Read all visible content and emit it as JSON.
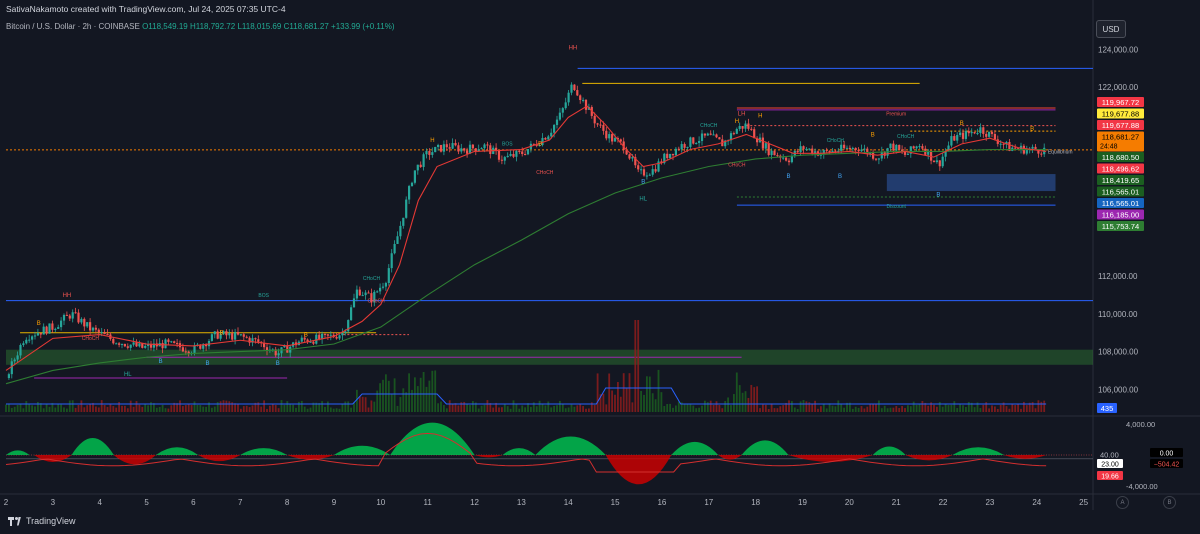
{
  "header": {
    "credit": "SativaNakamoto created with TradingView.com, Jul 24, 2025 07:35 UTC-4",
    "symbol": "Bitcoin / U.S. Dollar · 2h · COINBASE",
    "open": "O118,549.19",
    "high": "H118,792.72",
    "low": "L118,015.69",
    "close": "C118,681.27",
    "change": "+133.99 (+0.11%)"
  },
  "currency_button": "USD",
  "footer": {
    "brand": "TradingView",
    "btn_a": "A",
    "btn_b": "B"
  },
  "colors": {
    "background": "#131722",
    "up": "#26a69a",
    "down": "#ef5350",
    "bull_zone": "#2e7d32",
    "discount_zone": "#1e3a66",
    "ema": "#2e7d32",
    "sma": "#e53935"
  },
  "chart_data": [
    {
      "type": "candlestick",
      "title": "Bitcoin / U.S. Dollar · 2h · COINBASE",
      "y_axis_ticks": [
        "124,000.00",
        "122,000.00",
        "112,000.00",
        "110,000.00",
        "108,000.00",
        "106,000.00"
      ],
      "ylim": [
        104800,
        124500
      ],
      "x_ticks": [
        "2",
        "3",
        "4",
        "5",
        "6",
        "7",
        "8",
        "9",
        "10",
        "11",
        "12",
        "13",
        "14",
        "15",
        "16",
        "17",
        "18",
        "19",
        "20",
        "21",
        "22",
        "23",
        "24",
        "25"
      ],
      "xlim": [
        2,
        25.2
      ],
      "path": [
        [
          2,
          106600
        ],
        [
          2.4,
          108800
        ],
        [
          3,
          109300
        ],
        [
          3.4,
          110000
        ],
        [
          3.8,
          109200
        ],
        [
          4.3,
          108600
        ],
        [
          4.9,
          108200
        ],
        [
          5.4,
          108400
        ],
        [
          6,
          108100
        ],
        [
          6.5,
          108900
        ],
        [
          7,
          108800
        ],
        [
          7.4,
          108500
        ],
        [
          7.8,
          107900
        ],
        [
          8.3,
          108600
        ],
        [
          8.8,
          108700
        ],
        [
          9.2,
          109000
        ],
        [
          9.5,
          111300
        ],
        [
          9.8,
          110800
        ],
        [
          10.1,
          111800
        ],
        [
          10.4,
          114500
        ],
        [
          10.7,
          117500
        ],
        [
          11,
          118500
        ],
        [
          11.4,
          118900
        ],
        [
          11.8,
          118700
        ],
        [
          12.2,
          118900
        ],
        [
          12.6,
          118200
        ],
        [
          13,
          118500
        ],
        [
          13.3,
          119000
        ],
        [
          13.6,
          119600
        ],
        [
          13.85,
          120600
        ],
        [
          14.1,
          122200
        ],
        [
          14.35,
          121100
        ],
        [
          14.6,
          120100
        ],
        [
          14.9,
          119300
        ],
        [
          15.2,
          118900
        ],
        [
          15.5,
          117400
        ],
        [
          15.8,
          117600
        ],
        [
          16.1,
          118400
        ],
        [
          16.4,
          118900
        ],
        [
          16.7,
          119200
        ],
        [
          17,
          119400
        ],
        [
          17.3,
          119000
        ],
        [
          17.6,
          119800
        ],
        [
          17.8,
          120000
        ],
        [
          18,
          119400
        ],
        [
          18.3,
          118600
        ],
        [
          18.7,
          118200
        ],
        [
          19,
          118800
        ],
        [
          19.4,
          118500
        ],
        [
          19.8,
          118700
        ],
        [
          20.2,
          118800
        ],
        [
          20.6,
          118300
        ],
        [
          20.9,
          118900
        ],
        [
          21.2,
          118400
        ],
        [
          21.5,
          119000
        ],
        [
          21.9,
          117900
        ],
        [
          22.2,
          119300
        ],
        [
          22.5,
          119500
        ],
        [
          22.8,
          119800
        ],
        [
          23.1,
          119300
        ],
        [
          23.4,
          118800
        ],
        [
          23.8,
          118700
        ],
        [
          24.2,
          118681
        ]
      ],
      "ema_path": [
        [
          2,
          106300
        ],
        [
          3,
          107000
        ],
        [
          4,
          107400
        ],
        [
          5,
          107700
        ],
        [
          6,
          107900
        ],
        [
          7,
          108000
        ],
        [
          8,
          108100
        ],
        [
          9,
          108400
        ],
        [
          10,
          109300
        ],
        [
          11,
          111000
        ],
        [
          12,
          112600
        ],
        [
          13,
          113900
        ],
        [
          14,
          115300
        ],
        [
          15,
          116400
        ],
        [
          16,
          117200
        ],
        [
          17,
          117800
        ],
        [
          18,
          118200
        ],
        [
          19,
          118400
        ],
        [
          20,
          118500
        ],
        [
          21,
          118600
        ],
        [
          22,
          118600
        ],
        [
          23,
          118700
        ],
        [
          24.2,
          118700
        ]
      ],
      "sma_path": [
        [
          2,
          107000
        ],
        [
          3,
          108700
        ],
        [
          4,
          108900
        ],
        [
          5,
          108400
        ],
        [
          6,
          108300
        ],
        [
          7,
          108600
        ],
        [
          8,
          108300
        ],
        [
          9,
          108800
        ],
        [
          9.6,
          109600
        ],
        [
          10,
          110500
        ],
        [
          10.4,
          112600
        ],
        [
          10.8,
          116000
        ],
        [
          11.2,
          117800
        ],
        [
          12,
          118600
        ],
        [
          13,
          118700
        ],
        [
          13.6,
          119200
        ],
        [
          14,
          120400
        ],
        [
          14.4,
          121000
        ],
        [
          14.8,
          120000
        ],
        [
          15.2,
          118800
        ],
        [
          15.6,
          117800
        ],
        [
          16,
          118000
        ],
        [
          16.6,
          118700
        ],
        [
          17.2,
          119000
        ],
        [
          17.8,
          119500
        ],
        [
          18.2,
          119100
        ],
        [
          18.8,
          118500
        ],
        [
          19.4,
          118500
        ],
        [
          20,
          118600
        ],
        [
          20.6,
          118400
        ],
        [
          21.2,
          118600
        ],
        [
          21.8,
          118300
        ],
        [
          22.4,
          119000
        ],
        [
          23,
          119300
        ],
        [
          23.6,
          118800
        ],
        [
          24.2,
          118600
        ]
      ],
      "levels": [
        {
          "y": 123000,
          "x": [
            14.2,
            25.2
          ],
          "color": "#2962ff"
        },
        {
          "y": 122200,
          "x": [
            14.3,
            21.5
          ],
          "color": "#e6b400"
        },
        {
          "y": 120900,
          "x": [
            17.6,
            24.4
          ],
          "color": "#f44336"
        },
        {
          "y": 120800,
          "x": [
            17.6,
            24.4
          ],
          "color": "#9c27b0"
        },
        {
          "y": 119967,
          "x": [
            17.8,
            24.4
          ],
          "color": "#ef5350",
          "dash": true
        },
        {
          "y": 119677,
          "x": [
            21.3,
            24.4
          ],
          "color": "#ffa000",
          "dash": true
        },
        {
          "y": 118681,
          "x": [
            2,
            25.2
          ],
          "color": "#f57c00",
          "dash": true
        },
        {
          "y": 115753,
          "x": [
            17.6,
            24.4
          ],
          "color": "#2962ff"
        },
        {
          "y": 116185,
          "x": [
            17.6,
            24.4
          ],
          "color": "#2e7d32",
          "dash": true
        },
        {
          "y": 109000,
          "x": [
            2.3,
            9.9
          ],
          "color": "#e6b400"
        },
        {
          "y": 108900,
          "x": [
            9.2,
            10.6
          ],
          "color": "#ef5350",
          "dash": true
        },
        {
          "y": 110700,
          "x": [
            2,
            25.2
          ],
          "color": "#2962ff"
        },
        {
          "y": 107700,
          "x": [
            5,
            17.7
          ],
          "color": "#9c27b0"
        },
        {
          "y": 106600,
          "x": [
            2.6,
            8
          ],
          "color": "#9c27b0"
        }
      ],
      "zones": [
        {
          "y": [
            107300,
            108100
          ],
          "x": [
            2,
            25.2
          ],
          "color": "#2e7d32",
          "opacity": 0.45
        },
        {
          "y": [
            116500,
            117400
          ],
          "x": [
            20.8,
            24.4
          ],
          "color": "#2a4d8f",
          "opacity": 0.7
        }
      ],
      "labels": [
        {
          "text": "HH",
          "x": 3.3,
          "y": 110900,
          "color": "#ef5350"
        },
        {
          "text": "HL",
          "x": 4.6,
          "y": 106700,
          "color": "#26a69a"
        },
        {
          "text": "BOS",
          "x": 7.5,
          "y": 110900,
          "color": "#26a69a"
        },
        {
          "text": "HH",
          "x": 14.1,
          "y": 124000,
          "color": "#ef5350"
        },
        {
          "text": "LH",
          "x": 17.7,
          "y": 120500,
          "color": "#ef5350"
        },
        {
          "text": "HL",
          "x": 15.6,
          "y": 116000,
          "color": "#26a69a"
        },
        {
          "text": "Premium",
          "x": 21,
          "y": 120500,
          "color": "#ef5350"
        },
        {
          "text": "Discount",
          "x": 21,
          "y": 115600,
          "color": "#26a69a"
        },
        {
          "text": "Equilibrium",
          "x": 24.5,
          "y": 118500,
          "color": "#b2b5be"
        },
        {
          "text": "CHoCH",
          "x": 9.8,
          "y": 111800,
          "color": "#26a69a"
        },
        {
          "text": "CHoCH",
          "x": 17,
          "y": 119900,
          "color": "#26a69a"
        },
        {
          "text": "CHoCH",
          "x": 19.7,
          "y": 119100,
          "color": "#26a69a"
        },
        {
          "text": "CHoCH",
          "x": 21.2,
          "y": 119300,
          "color": "#26a69a"
        },
        {
          "text": "CHoCH",
          "x": 3.8,
          "y": 108600,
          "color": "#ef5350"
        },
        {
          "text": "CHoCH",
          "x": 9.9,
          "y": 110600,
          "color": "#ef5350"
        },
        {
          "text": "CHoCH",
          "x": 13.5,
          "y": 117400,
          "color": "#ef5350"
        },
        {
          "text": "CHoCH",
          "x": 17.6,
          "y": 117800,
          "color": "#ef5350"
        },
        {
          "text": "BOS",
          "x": 12.7,
          "y": 118900,
          "color": "#26a69a"
        },
        {
          "text": "H",
          "x": 11.1,
          "y": 119100,
          "color": "#ffa000"
        },
        {
          "text": "H",
          "x": 17.6,
          "y": 120100,
          "color": "#ffa000"
        },
        {
          "text": "H",
          "x": 18.1,
          "y": 120400,
          "color": "#ffa000"
        },
        {
          "text": "B",
          "x": 2.7,
          "y": 109400,
          "color": "#ffa000"
        },
        {
          "text": "B",
          "x": 6.6,
          "y": 108900,
          "color": "#ffa000"
        },
        {
          "text": "B",
          "x": 8.4,
          "y": 108800,
          "color": "#ffa000"
        },
        {
          "text": "B",
          "x": 13.4,
          "y": 118900,
          "color": "#ffa000"
        },
        {
          "text": "B",
          "x": 20.5,
          "y": 119400,
          "color": "#ffa000"
        },
        {
          "text": "B",
          "x": 22.4,
          "y": 120000,
          "color": "#ffa000"
        },
        {
          "text": "B",
          "x": 23.9,
          "y": 119700,
          "color": "#ffa000"
        },
        {
          "text": "B",
          "x": 5.3,
          "y": 107400,
          "color": "#42a5f5"
        },
        {
          "text": "B",
          "x": 6.3,
          "y": 107300,
          "color": "#42a5f5"
        },
        {
          "text": "B",
          "x": 7.8,
          "y": 107300,
          "color": "#42a5f5"
        },
        {
          "text": "B",
          "x": 15.6,
          "y": 116900,
          "color": "#42a5f5"
        },
        {
          "text": "B",
          "x": 18.7,
          "y": 117200,
          "color": "#42a5f5"
        },
        {
          "text": "B",
          "x": 19.8,
          "y": 117200,
          "color": "#42a5f5"
        },
        {
          "text": "B",
          "x": 21.9,
          "y": 116200,
          "color": "#42a5f5"
        }
      ],
      "price_tags": [
        {
          "label": "119,967.72",
          "y": 119967,
          "bg": "#f23645",
          "fg": "#ffffff"
        },
        {
          "label": "119,677.88",
          "y": 119677,
          "bg": "#ffeb3b",
          "fg": "#000000"
        },
        {
          "label": "119,677.88",
          "y": 119677,
          "bg": "#f23645",
          "fg": "#ffffff",
          "offset": 1
        },
        {
          "label": "118,681.27",
          "sub": "24:48",
          "y": 118681,
          "bg": "#f57c00",
          "fg": "#000000"
        },
        {
          "label": "118,680.50",
          "y": 118680,
          "bg": "#1b5e20",
          "fg": "#ffffff",
          "offset": 1
        },
        {
          "label": "118,496.62",
          "y": 118496,
          "bg": "#f23645",
          "fg": "#ffffff",
          "offset": 2
        },
        {
          "label": "118,419.65",
          "y": 118419,
          "bg": "#1b5e20",
          "fg": "#ffffff",
          "offset": 3
        },
        {
          "label": "116,565.01",
          "y": 116565,
          "bg": "#1b5e20",
          "fg": "#ffffff",
          "offset": 4
        },
        {
          "label": "116,565.01",
          "y": 116565,
          "bg": "#1565c0",
          "fg": "#ffffff",
          "offset": 5
        },
        {
          "label": "116,185.00",
          "y": 116185,
          "bg": "#9c27b0",
          "fg": "#ffffff",
          "offset": 6
        },
        {
          "label": "115,753.74",
          "y": 115753,
          "bg": "#2e7d32",
          "fg": "#ffffff",
          "offset": 7
        }
      ],
      "volume_tag": "435"
    },
    {
      "type": "oscillator",
      "y_axis_ticks": [
        "4,000.00",
        "40.00",
        "-4,000.00"
      ],
      "ylim": [
        -4800,
        4800
      ],
      "values_tags": [
        {
          "label": "0.00",
          "bg": "#000000",
          "fg": "#ffffff",
          "y": 0
        },
        {
          "label": "−504.42",
          "bg": "#000000",
          "fg": "#ef5350",
          "y": -504
        },
        {
          "label": "23.00",
          "bg": "#ffffff",
          "fg": "#000000",
          "y": -600
        },
        {
          "label": "19.66",
          "bg": "#f23645",
          "fg": "#ffffff",
          "y": -1800
        }
      ],
      "humps": [
        [
          2,
          2.5,
          600
        ],
        [
          2.6,
          3.4,
          -900
        ],
        [
          3.4,
          4.3,
          2200
        ],
        [
          4.3,
          5.2,
          -1200
        ],
        [
          5.2,
          6.1,
          1000
        ],
        [
          6.1,
          7,
          -800
        ],
        [
          7,
          8,
          900
        ],
        [
          8,
          9,
          -600
        ],
        [
          9,
          10.2,
          1200
        ],
        [
          10.2,
          12,
          4200
        ],
        [
          12,
          12.6,
          -300
        ],
        [
          12.6,
          13.3,
          900
        ],
        [
          13.3,
          14.8,
          2400
        ],
        [
          14.8,
          16.2,
          -3800
        ],
        [
          16.2,
          17.2,
          1700
        ],
        [
          17.2,
          17.7,
          -600
        ],
        [
          17.7,
          18.7,
          1900
        ],
        [
          18.7,
          20.5,
          -900
        ],
        [
          20.5,
          21.2,
          1100
        ],
        [
          21.2,
          22.2,
          -700
        ],
        [
          22.2,
          23.3,
          1000
        ],
        [
          23.3,
          24.2,
          -500
        ]
      ]
    }
  ]
}
